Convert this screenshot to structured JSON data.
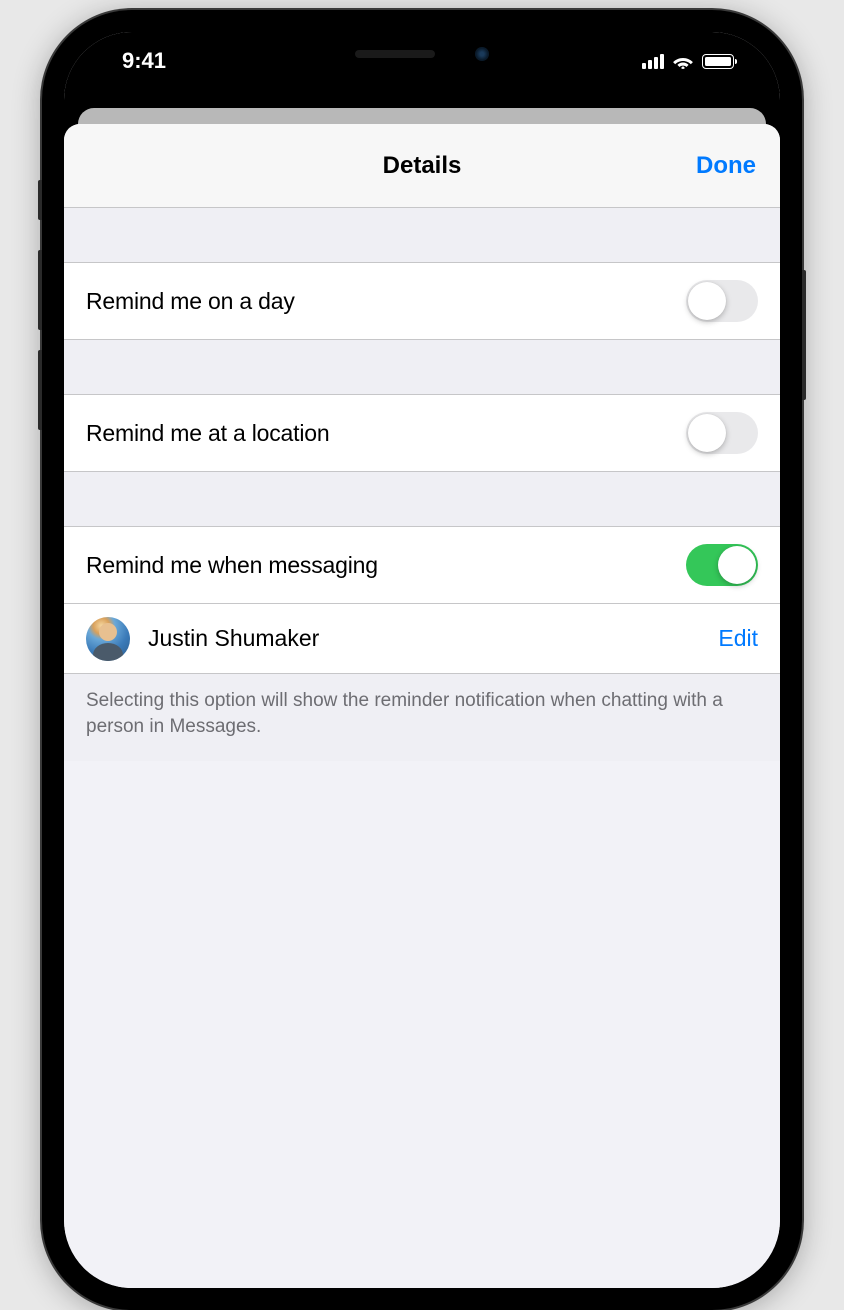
{
  "status": {
    "time": "9:41"
  },
  "nav": {
    "title": "Details",
    "done": "Done"
  },
  "rows": {
    "day": {
      "label": "Remind me on a day",
      "on": false
    },
    "location": {
      "label": "Remind me at a location",
      "on": false
    },
    "messaging": {
      "label": "Remind me when messaging",
      "on": true
    }
  },
  "contact": {
    "name": "Justin Shumaker",
    "edit": "Edit"
  },
  "footer": "Selecting this option will show the reminder notification when chatting with a person in Messages."
}
